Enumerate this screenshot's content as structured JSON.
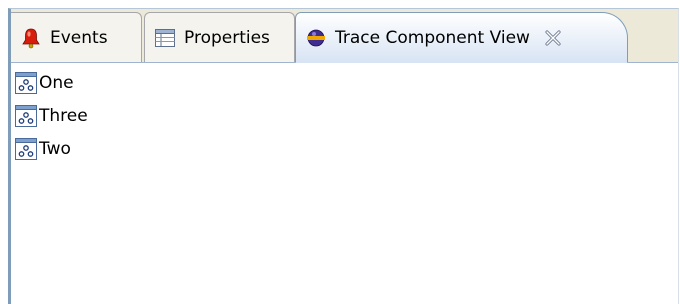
{
  "tabs": [
    {
      "label": "Events",
      "icon": "bell-icon"
    },
    {
      "label": "Properties",
      "icon": "properties-table-icon"
    },
    {
      "label": "Trace Component View",
      "icon": "trace-view-icon",
      "active": true
    }
  ],
  "tree": {
    "items": [
      {
        "label": "One",
        "icon": "component-icon"
      },
      {
        "label": "Three",
        "icon": "component-icon"
      },
      {
        "label": "Two",
        "icon": "component-icon"
      }
    ]
  },
  "colors": {
    "active_tab_gradient_end": "#d8e4f4",
    "frame_border": "#7f9db9",
    "tabbar_bg": "#ece9d8"
  }
}
